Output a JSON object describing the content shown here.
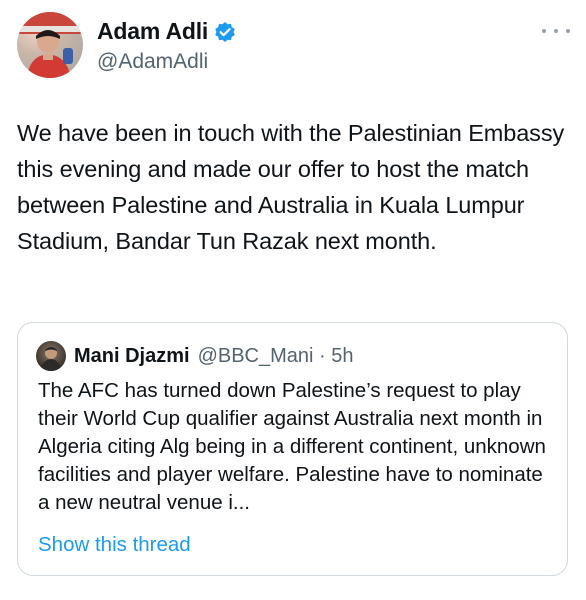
{
  "author": {
    "display_name": "Adam Adli",
    "handle": "@AdamAdli",
    "avatar_icon": "profile-photo",
    "verified_icon": "verified-badge-icon"
  },
  "more_icon": "more-horizontal-icon",
  "tweet_text": "We have been in touch with the Palestinian Embassy this evening and made our offer to host the match between Palestine and Australia in Kuala Lumpur Stadium, Bandar Tun Razak next month.",
  "quote": {
    "display_name": "Mani Djazmi",
    "handle_time": "@BBC_Mani · 5h",
    "text": "The AFC has turned down Palestine’s request to play their World Cup qualifier against Australia next month in Algeria citing Alg being in a different continent, unknown facilities and player welfare. Palestine have to nominate a new neutral venue i...",
    "link_label": "Show this thread"
  },
  "colors": {
    "text": "#0f1419",
    "secondary": "#536471",
    "link": "#1d9bf0",
    "border": "#cfd9de"
  }
}
